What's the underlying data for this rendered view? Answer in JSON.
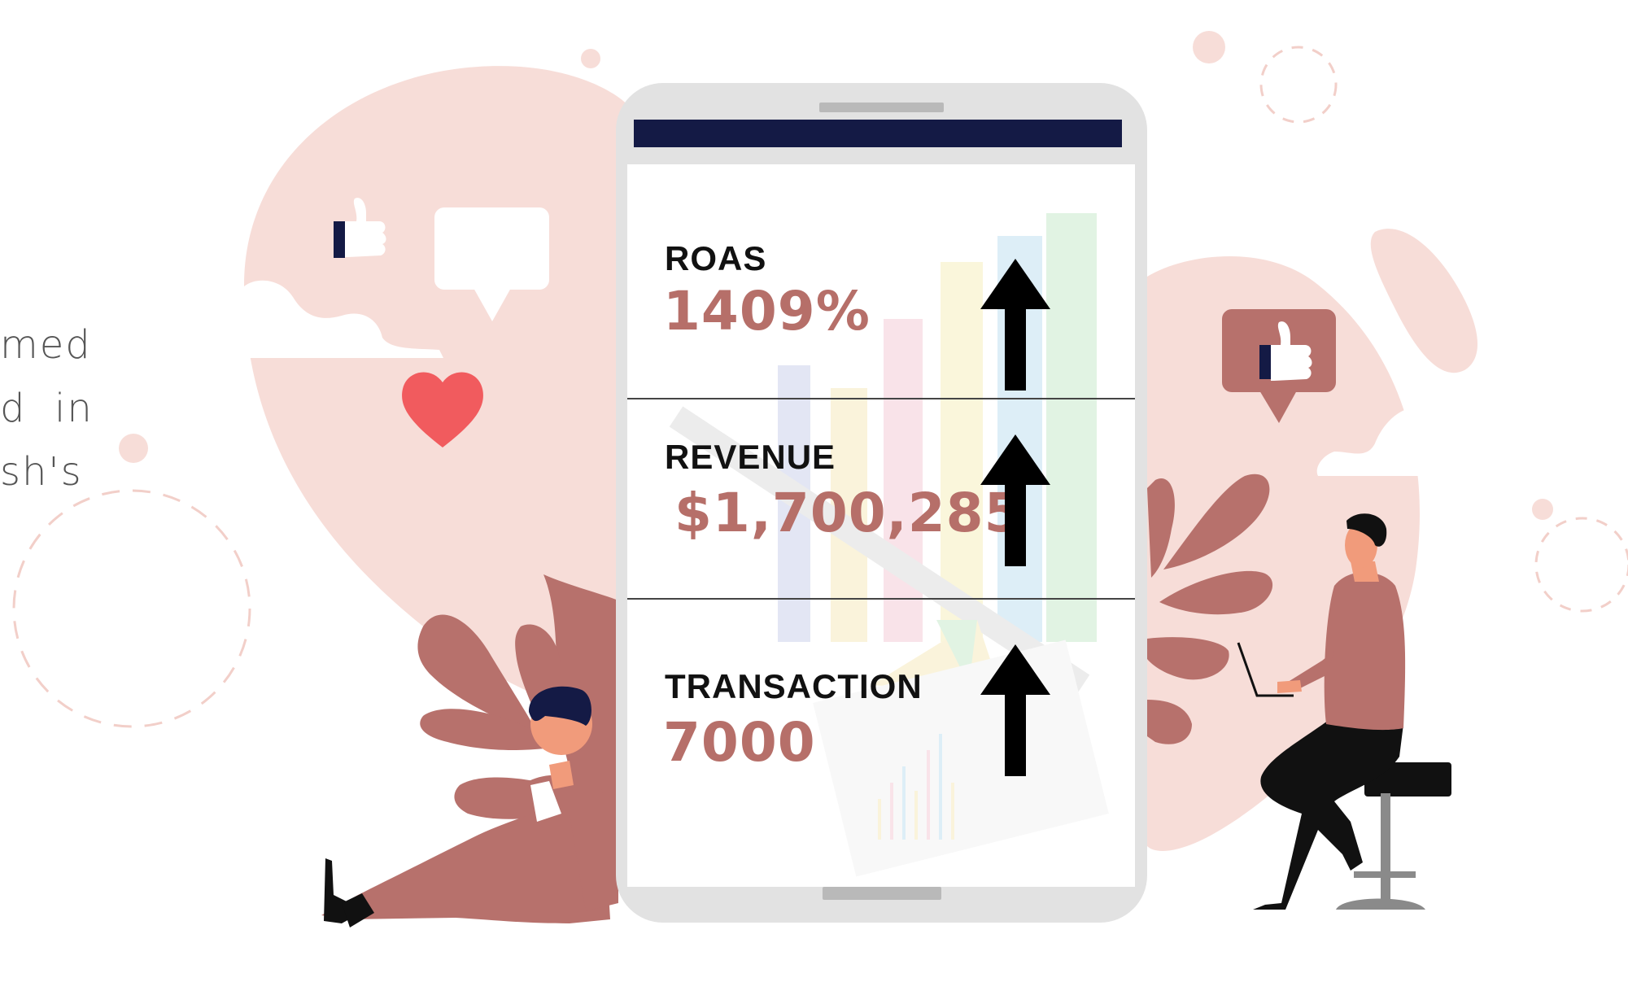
{
  "side_text": {
    "line1": "med",
    "line2": "d  in",
    "line3": "sh's"
  },
  "metrics": [
    {
      "label": "ROAS",
      "value": "1409%",
      "trend": "up"
    },
    {
      "label": "REVENUE",
      "value": "$1,700,285",
      "trend": "up"
    },
    {
      "label": "TRANSACTION",
      "value": "7000",
      "trend": "up"
    }
  ],
  "colors": {
    "blob": "#f7ddd8",
    "accent": "#b7716c",
    "value_text": "#b66f69",
    "heart": "#f15b5e",
    "navy": "#141a45",
    "phone_frame": "#e2e2e2",
    "dashed_circle": "#f2cfc9"
  },
  "icons": [
    "thumbs-up-icon",
    "speech-bubble-icon",
    "heart-icon",
    "up-arrow-icon"
  ]
}
